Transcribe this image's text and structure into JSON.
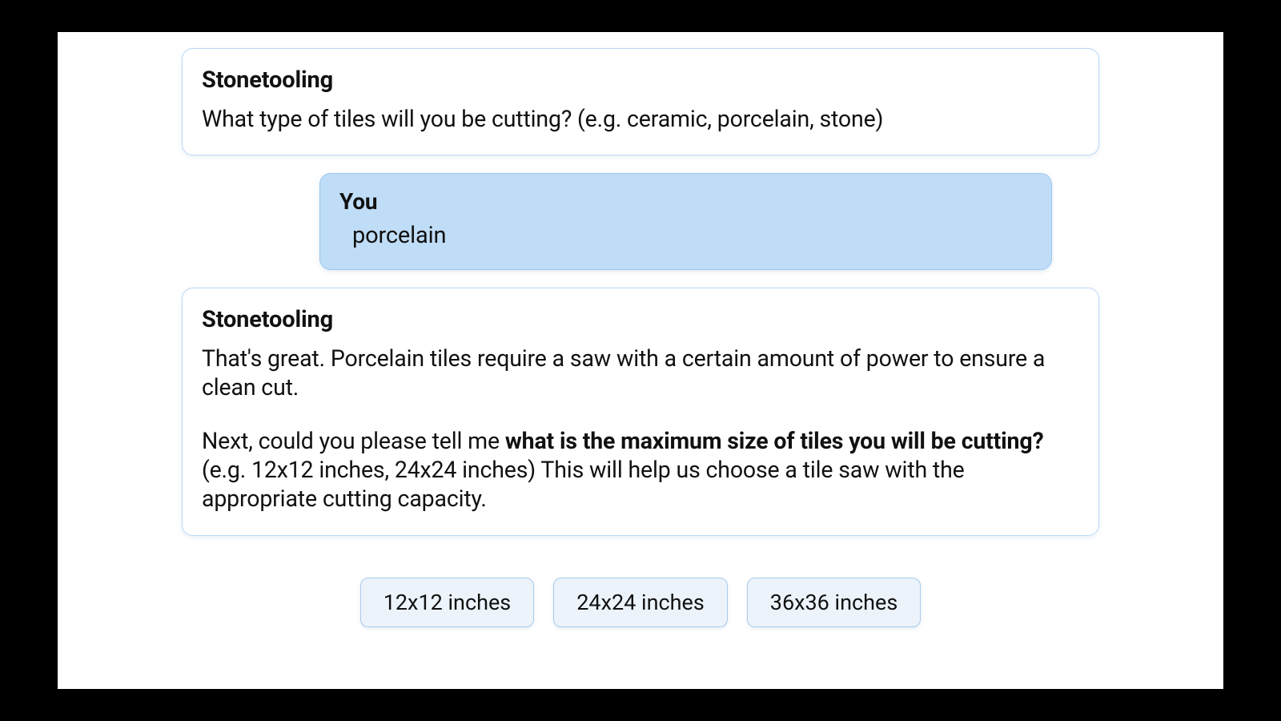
{
  "bot_name": "Stonetooling",
  "user_name": "You",
  "messages": {
    "bot1": {
      "sender": "Stonetooling",
      "body": "What type of tiles will you be cutting? (e.g. ceramic, porcelain, stone)"
    },
    "user1": {
      "sender": "You",
      "body": "porcelain"
    },
    "bot2": {
      "sender": "Stonetooling",
      "p1": "That's great. Porcelain tiles require a saw with a certain amount of power to ensure a clean cut.",
      "p2_pre": "Next, could you please tell me ",
      "p2_bold": "what is the maximum size of tiles you will be cutting?",
      "p2_post": " (e.g. 12x12 inches, 24x24 inches) This will help us choose a tile saw with the appropriate cutting capacity."
    }
  },
  "quick_replies": [
    "12x12 inches",
    "24x24 inches",
    "36x36 inches"
  ]
}
